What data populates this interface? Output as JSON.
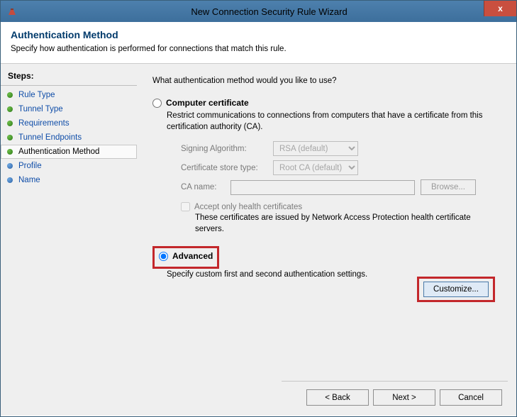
{
  "window": {
    "title": "New Connection Security Rule Wizard",
    "close": "x"
  },
  "header": {
    "title": "Authentication Method",
    "subtitle": "Specify how authentication is performed for connections that match this rule."
  },
  "sidebar": {
    "label": "Steps:",
    "items": [
      {
        "label": "Rule Type"
      },
      {
        "label": "Tunnel Type"
      },
      {
        "label": "Requirements"
      },
      {
        "label": "Tunnel Endpoints"
      },
      {
        "label": "Authentication Method"
      },
      {
        "label": "Profile"
      },
      {
        "label": "Name"
      }
    ]
  },
  "main": {
    "prompt": "What authentication method would you like to use?",
    "option1": {
      "label": "Computer certificate",
      "desc": "Restrict communications to connections from computers that have a certificate from this certification authority (CA).",
      "signing_label": "Signing Algorithm:",
      "signing_value": "RSA (default)",
      "store_label": "Certificate store type:",
      "store_value": "Root CA (default)",
      "ca_label": "CA name:",
      "ca_value": "",
      "browse": "Browse...",
      "health_check": "Accept only health certificates",
      "health_desc": "These certificates are issued by Network Access Protection health certificate servers."
    },
    "option2": {
      "label": "Advanced",
      "desc": "Specify custom first and second authentication settings.",
      "customize": "Customize..."
    }
  },
  "footer": {
    "back": "< Back",
    "next": "Next >",
    "cancel": "Cancel"
  }
}
